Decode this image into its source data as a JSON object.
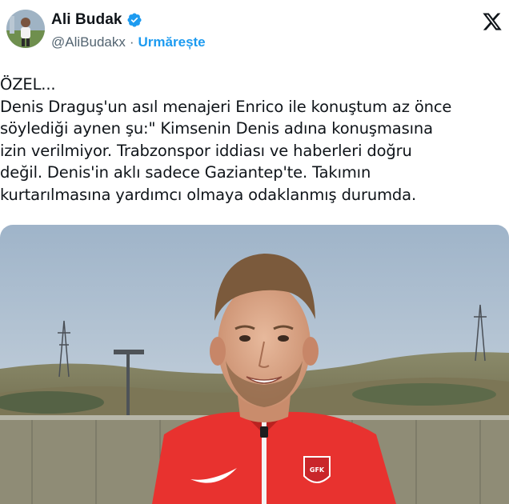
{
  "author": {
    "display_name": "Ali Budak",
    "handle": "@AliBudakx",
    "separator": "·",
    "follow_label": "Urmărește",
    "verified": true,
    "avatar_icon": "profile-photo",
    "verified_icon": "verified-badge-icon"
  },
  "brand": {
    "logo_icon": "x-logo-icon"
  },
  "tweet": {
    "text": "ÖZEL...\nDenis Draguş'un asıl menajeri Enrico ile konuştum az önce\nsöylediği aynen şu:\" Kimsenin Denis adına konuşmasına\nizin verilmiyor. Trabzonspor iddiası ve haberleri doğru\ndeğil. Denis'in aklı sadece Gaziantep'te. Takımın\nkurtarılmasına yardımcı olmaya odaklanmış durumda."
  },
  "media": {
    "type": "photo",
    "crest_text": "GFK"
  },
  "colors": {
    "accent": "#1d9bf0",
    "text": "#0f1419",
    "secondary": "#536471",
    "jersey": "#e8322f"
  }
}
